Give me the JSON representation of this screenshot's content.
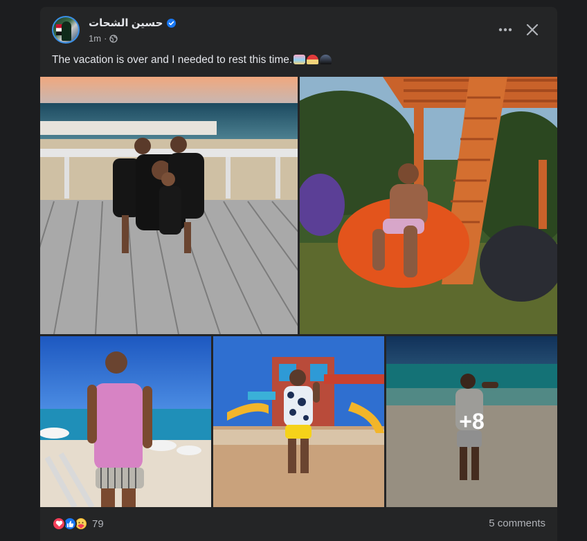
{
  "post": {
    "author": "حسين الشحات",
    "time": "1m",
    "separator": "·",
    "caption": "The vacation is over and I needed to rest this time.",
    "more_photos": "+8",
    "reaction_count": "79",
    "comments": "5 comments"
  },
  "icons": {
    "verified": "verified-badge-icon",
    "privacy": "globe-icon",
    "more": "more-options-icon",
    "close": "close-icon",
    "reactions": [
      "love-icon",
      "like-icon",
      "care-icon"
    ]
  },
  "colors": {
    "background": "#1c1d1f",
    "card": "#242526",
    "text": "#e4e6eb",
    "secondary_text": "#b0b3b8",
    "verified": "#1877f2",
    "love": "#f33e58",
    "like": "#1877f2",
    "care": "#f7b125"
  }
}
